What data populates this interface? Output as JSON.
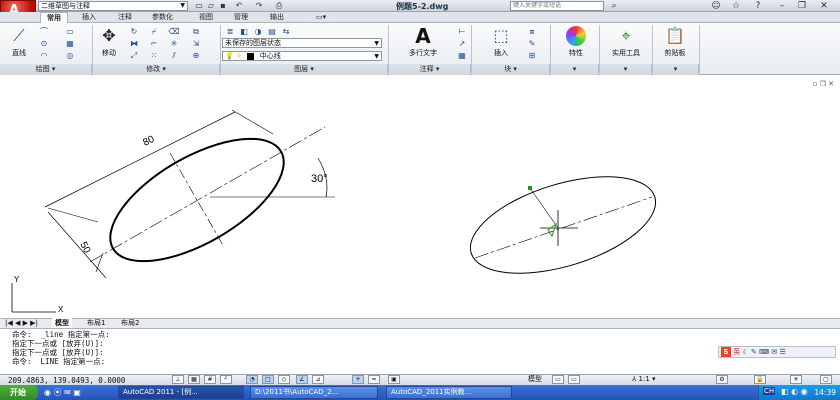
{
  "titlebar": {
    "app_letter": "A",
    "workspace": "二维草图与注释",
    "doc_title": "例题5-2.dwg",
    "search_placeholder": "键入关键字或短语",
    "qat_icons": [
      "new-icon",
      "open-icon",
      "save-icon",
      "undo-icon",
      "redo-icon",
      "print-icon"
    ],
    "window_icons": [
      "find-icon",
      "user-icon",
      "star-icon",
      "help-icon"
    ]
  },
  "tabs": [
    "常用",
    "插入",
    "注释",
    "参数化",
    "视图",
    "管理",
    "输出"
  ],
  "ribbon": {
    "draw": {
      "line_label": "直线",
      "panel": "绘图"
    },
    "modify": {
      "move_label": "移动",
      "panel": "修改"
    },
    "layers": {
      "state": "未保存的图层状态",
      "current_layer": "中心线",
      "panel": "图层"
    },
    "annotation": {
      "mtext_label": "多行文字",
      "panel": "注释"
    },
    "block": {
      "insert_label": "插入",
      "panel": "块"
    },
    "properties": {
      "label": "特性"
    },
    "utilities": {
      "label": "实用工具"
    },
    "clipboard": {
      "label": "剪贴板"
    }
  },
  "drawing": {
    "dim_major": "80",
    "dim_minor": "50",
    "dim_angle": "30°",
    "ucs_y": "Y",
    "ucs_x": "X"
  },
  "layout_tabs": [
    "模型",
    "布局1",
    "布局2"
  ],
  "command": {
    "lines": [
      "命令:  _line 指定第一点:",
      "指定下一点或 [放弃(U)]:",
      "指定下一点或 [放弃(U)]:",
      "命令:  LINE 指定第一点:"
    ]
  },
  "ime": {
    "label": "英"
  },
  "status": {
    "coords": "209.4863,  139.0493,  0.0000",
    "model_label": "模型",
    "scale": "1:1"
  },
  "taskbar": {
    "start": "开始",
    "tasks": [
      "AutoCAD 2011 - [例...",
      "D:\\2011书\\AutoCAD_2...",
      "AutoCAD_2011实例教..."
    ],
    "tray_label": "CH",
    "clock": "14:39"
  },
  "colors": {
    "accent": "#c0140b",
    "taskbar": "#2a5cc4",
    "cursor_green": "#1a9a1a"
  }
}
